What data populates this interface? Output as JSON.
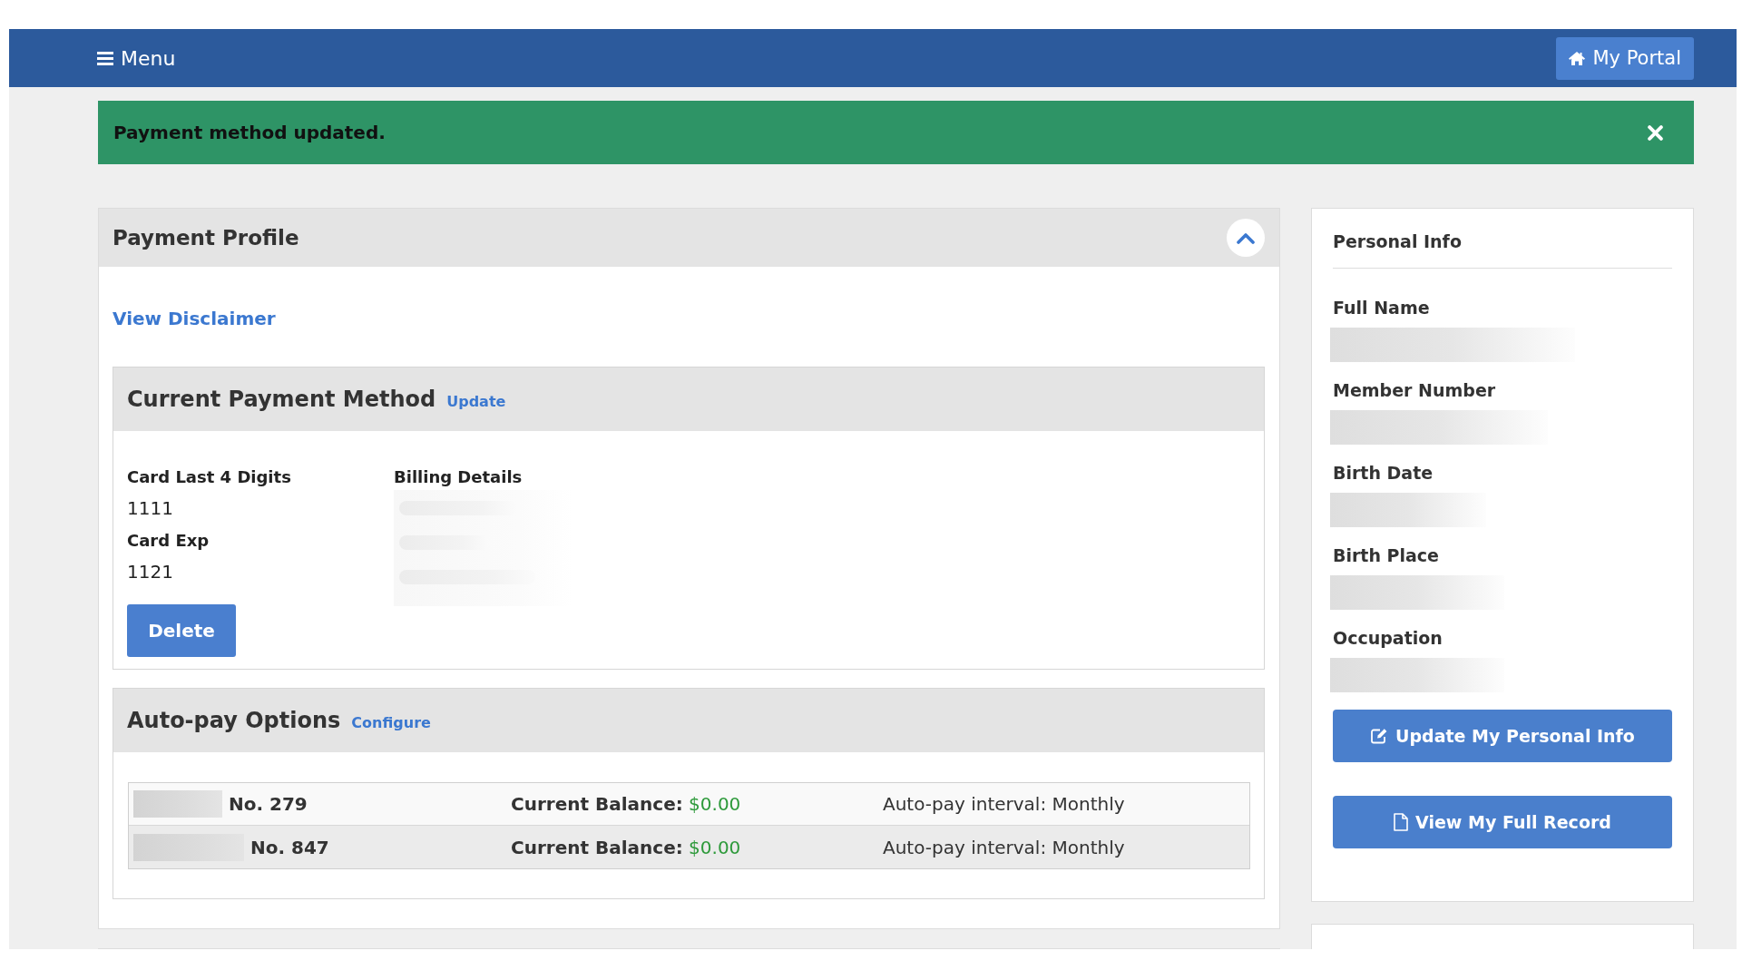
{
  "navbar": {
    "menu_label": "Menu",
    "portal_label": "My Portal"
  },
  "alert": {
    "message": "Payment method updated."
  },
  "payment_profile": {
    "title": "Payment Profile",
    "expanded": true,
    "disclaimer_link": "View Disclaimer",
    "current_payment_method": {
      "title": "Current Payment Method",
      "action_link": "Update",
      "card_fields": [
        {
          "label": "Card Last 4 Digits",
          "value": "1111"
        },
        {
          "label": "Card Exp",
          "value": "1121"
        }
      ],
      "delete_button": "Delete",
      "billing_label": "Billing Details"
    },
    "autopay_options": {
      "title": "Auto-pay Options",
      "action_link": "Configure",
      "rows": [
        {
          "number": "No. 279",
          "balance_label": "Current Balance:",
          "balance": "$0.00",
          "interval": "Auto-pay interval: Monthly"
        },
        {
          "number": "No. 847",
          "balance_label": "Current Balance:",
          "balance": "$0.00",
          "interval": "Auto-pay interval: Monthly"
        }
      ]
    }
  },
  "personal_info": {
    "title": "Personal Info",
    "fields": [
      {
        "label": "Full Name"
      },
      {
        "label": "Member Number"
      },
      {
        "label": "Birth Date"
      },
      {
        "label": "Birth Place"
      },
      {
        "label": "Occupation"
      }
    ],
    "buttons": [
      {
        "label": "Update My Personal Info",
        "kind": "edit"
      },
      {
        "label": "View My Full Record",
        "kind": "record"
      }
    ]
  }
}
